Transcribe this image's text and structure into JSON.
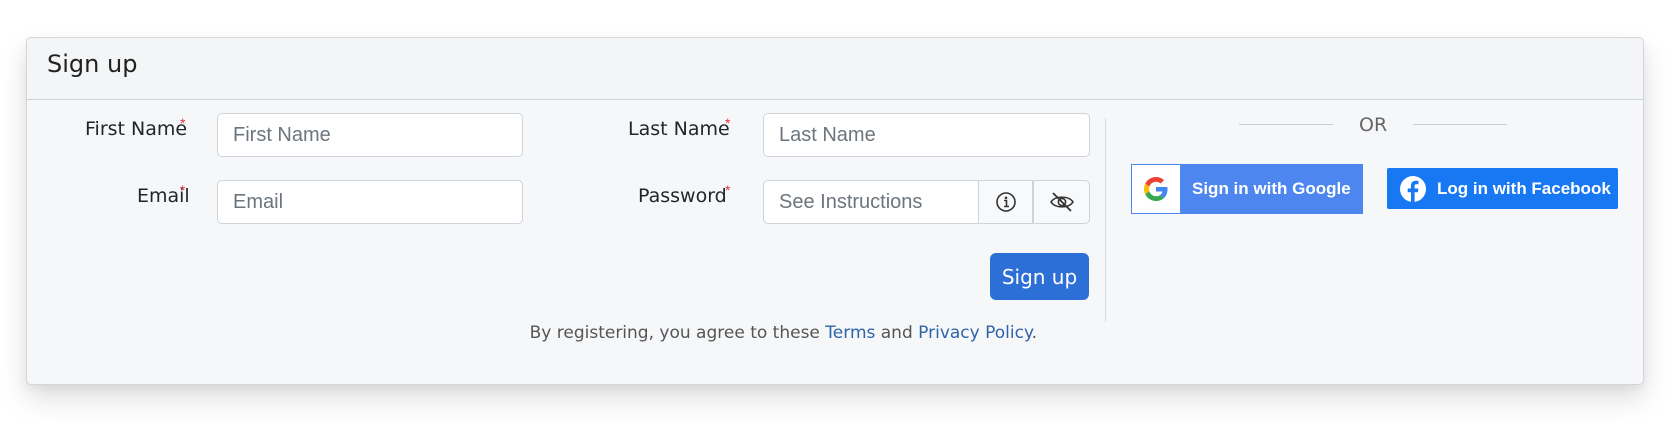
{
  "header": {
    "title": "Sign up"
  },
  "form": {
    "first_name": {
      "label": "First Name",
      "required_mark": "*",
      "placeholder": "First Name"
    },
    "last_name": {
      "label": "Last Name",
      "required_mark": "*",
      "placeholder": "Last Name"
    },
    "email": {
      "label": "Email",
      "required_mark": "*",
      "placeholder": "Email"
    },
    "password": {
      "label": "Password",
      "required_mark": "*",
      "placeholder": "See Instructions"
    },
    "submit_label": "Sign up"
  },
  "terms": {
    "prefix": "By registering, you agree to these ",
    "terms_link": "Terms",
    "middle": " and ",
    "privacy_link": "Privacy Policy",
    "suffix": "."
  },
  "social": {
    "or_label": "OR",
    "google_label": "Sign in with Google",
    "facebook_label": "Log in with Facebook"
  },
  "icons": {
    "password_info": "info-icon",
    "password_toggle": "eye-slash-icon",
    "google": "google-icon",
    "facebook": "facebook-icon"
  },
  "colors": {
    "primary_button": "#2c6fd6",
    "google_button": "#4d86ee",
    "facebook_button": "#1877f2",
    "required": "#dc3545",
    "link": "#2f63a8"
  }
}
